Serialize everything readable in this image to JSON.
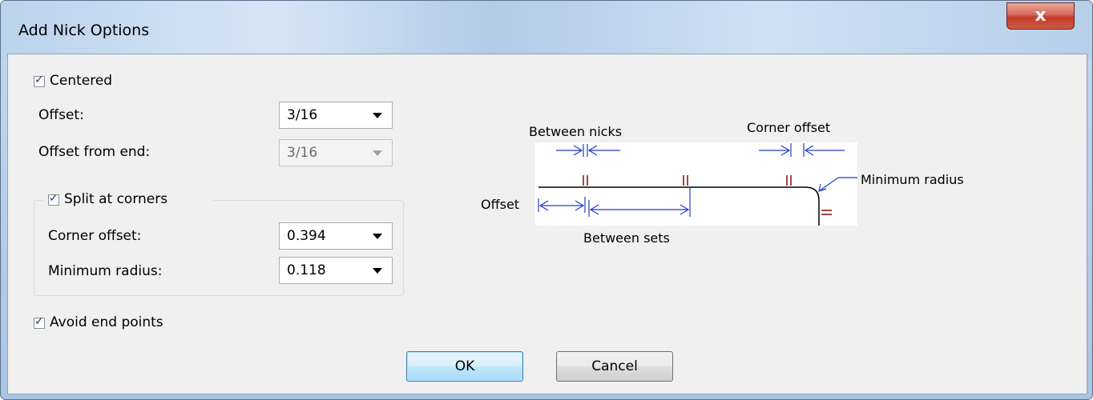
{
  "window": {
    "title": "Add Nick Options",
    "close_glyph": "x"
  },
  "options": {
    "centered": {
      "label": "Centered",
      "checked": true
    },
    "offset": {
      "label": "Offset:",
      "value": "3/16"
    },
    "offset_from_end": {
      "label": "Offset from end:",
      "value": "3/16",
      "enabled": false
    },
    "split_at_corners": {
      "label": "Split at corners",
      "checked": true
    },
    "corner_offset": {
      "label": "Corner offset:",
      "value": "0.394"
    },
    "minimum_radius": {
      "label": "Minimum radius:",
      "value": "0.118"
    },
    "avoid_end_points": {
      "label": "Avoid end points",
      "checked": true
    }
  },
  "diagram": {
    "between_nicks": "Between nicks",
    "corner_offset": "Corner offset",
    "minimum_radius": "Minimum radius",
    "offset": "Offset",
    "between_sets": "Between sets",
    "colors": {
      "arrows": "#1f3fbf",
      "nicks": "#8b1a1a",
      "edge": "#000000"
    }
  },
  "buttons": {
    "ok": "OK",
    "cancel": "Cancel"
  },
  "icons": {
    "check": "check-icon",
    "dropdown": "chevron-down-icon",
    "close": "close-icon"
  }
}
